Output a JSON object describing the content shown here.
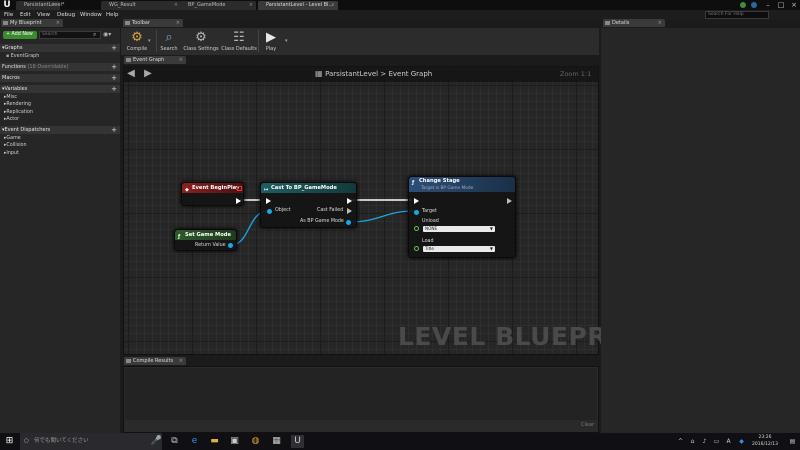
{
  "window": {
    "logo": "U",
    "tabs": [
      "ParsistantLevel*",
      "WG_Result",
      "BP_GameMode",
      "ParsistantLevel - Level Bl..."
    ]
  },
  "menu": [
    "File",
    "Edit",
    "View",
    "Debug",
    "Window",
    "Help"
  ],
  "search_help_placeholder": "Search For Help",
  "my_blueprint": {
    "tab": "My Blueprint",
    "add_new": "+ Add New",
    "search_placeholder": "Search",
    "graphs_label": "Graphs",
    "event_graph_item": "EventGraph",
    "functions_label": "Functions",
    "functions_count": "(18 Overridable)",
    "macros_label": "Macros",
    "variables_label": "Variables",
    "variable_cats": [
      "Misc",
      "Rendering",
      "Replication",
      "Actor"
    ],
    "dispatchers_label": "Event Dispatchers",
    "dispatcher_cats": [
      "Game",
      "Collision",
      "Input"
    ]
  },
  "toolbar": {
    "tab": "Toolbar",
    "buttons": [
      "Compile",
      "Search",
      "Class Settings",
      "Class Defaults",
      "Play"
    ]
  },
  "graph": {
    "tab": "Event Graph",
    "breadcrumb_root": "ParsistantLevel",
    "breadcrumb_sep": ">",
    "breadcrumb_leaf": "Event Graph",
    "zoom": "Zoom 1:1",
    "watermark": "LEVEL BLUEPRINT"
  },
  "nodes": {
    "begin_play": {
      "title": "Event BeginPlay"
    },
    "set_game_mode": {
      "title": "Set Game Mode",
      "return_value": "Return Value"
    },
    "cast": {
      "title": "Cast To BP_GameMode",
      "object": "Object",
      "cast_failed": "Cast Failed",
      "as_output": "As BP Game Mode"
    },
    "change_stage": {
      "title": "Change Stage",
      "subtitle": "Target is BP Game Mode",
      "target": "Target",
      "unload_label": "Unload",
      "unload_value": "NONE",
      "load_label": "Load",
      "load_value": "Title"
    }
  },
  "compile_results": {
    "tab": "Compile Results",
    "clear": "Clear"
  },
  "details": {
    "tab": "Details"
  },
  "taskbar": {
    "search_placeholder": "何でも聞いてください",
    "time": "23:26",
    "date": "2016/12/13"
  },
  "colors": {
    "event_red": "#8e1f1f",
    "cast_teal": "#1e5e62",
    "function_blue": "#2d4f78",
    "pure_green": "#2f5b2b",
    "wire_blue": "#16a9e8"
  }
}
